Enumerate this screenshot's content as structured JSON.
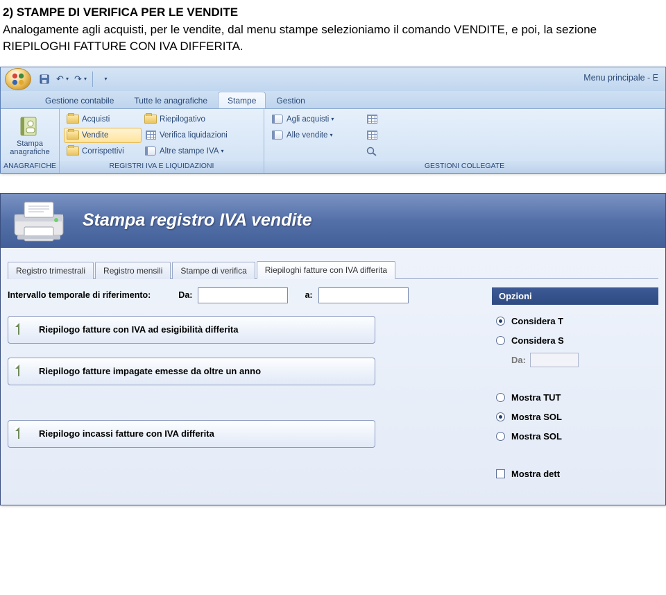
{
  "doc": {
    "heading": "2) STAMPE DI VERIFICA PER LE VENDITE",
    "para": "Analogamente agli acquisti, per le vendite, dal menu stampe selezioniamo il comando VENDITE, e poi, la sezione RIEPILOGHI FATTURE CON IVA DIFFERITA."
  },
  "app1": {
    "qat_title": "Menu principale - E",
    "tabs": {
      "t1": "Gestione contabile",
      "t2": "Tutte le anagrafiche",
      "t3": "Stampe",
      "t4": "Gestion"
    },
    "groups": {
      "g1": {
        "label": "ANAGRAFICHE",
        "btn1_l1": "Stampa",
        "btn1_l2": "anagrafiche"
      },
      "g2": {
        "label": "REGISTRI IVA E LIQUIDAZIONI",
        "b_acquisti": "Acquisti",
        "b_vendite": "Vendite",
        "b_corr": "Corrispettivi",
        "b_riep": "Riepilogativo",
        "b_verif": "Verifica liquidazioni",
        "b_altre": "Altre stampe IVA"
      },
      "g3": {
        "label": "GESTIONI COLLEGATE",
        "b_agli": "Agli acquisti",
        "b_alle": "Alle vendite"
      }
    }
  },
  "app2": {
    "title": "Stampa registro IVA vendite",
    "subtabs": {
      "t1": "Registro trimestrali",
      "t2": "Registro mensili",
      "t3": "Stampe di verifica",
      "t4": "Riepiloghi fatture con IVA differita"
    },
    "form": {
      "interval_lbl": "Intervallo temporale di riferimento:",
      "da_lbl": "Da:",
      "a_lbl": "a:"
    },
    "buttons": {
      "b1": "Riepilogo fatture con IVA ad esigibilità differita",
      "b2": "Riepilogo fatture impagate emesse da oltre un anno",
      "b3": "Riepilogo incassi fatture con IVA differita"
    },
    "opts": {
      "head": "Opzioni",
      "r1": "Considera T",
      "r2": "Considera S",
      "da": "Da:",
      "r3": "Mostra TUT",
      "r4": "Mostra SOL",
      "r5": "Mostra SOL",
      "c1": "Mostra dett"
    }
  }
}
